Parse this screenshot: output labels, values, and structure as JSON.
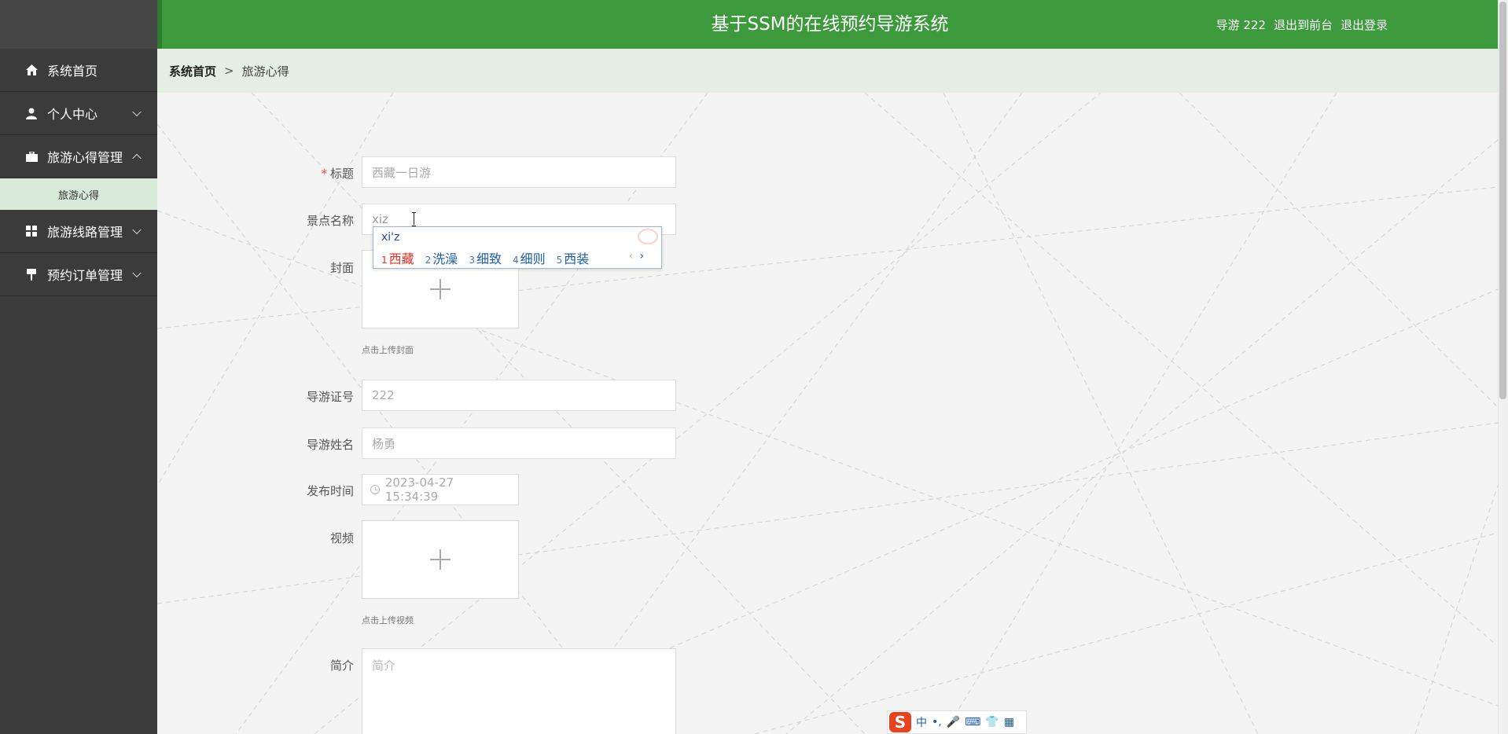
{
  "header": {
    "title": "基于SSM的在线预约导游系统",
    "user": "导游 222",
    "to_frontend": "退出到前台",
    "logout": "退出登录"
  },
  "sidebar": {
    "items": [
      {
        "label": "系统首页",
        "icon": "home-icon"
      },
      {
        "label": "个人中心",
        "icon": "user-icon"
      },
      {
        "label": "旅游心得管理",
        "icon": "briefcase-icon"
      },
      {
        "label": "旅游线路管理",
        "icon": "grid-icon"
      },
      {
        "label": "预约订单管理",
        "icon": "pin-icon"
      }
    ],
    "sub_items": [
      {
        "label": "旅游心得"
      }
    ]
  },
  "breadcrumb": {
    "home": "系统首页",
    "separator": ">",
    "current": "旅游心得"
  },
  "form": {
    "title": {
      "label": "标题",
      "required_mark": "*",
      "placeholder": "西藏一日游"
    },
    "spot": {
      "label": "景点名称",
      "value": "xiz"
    },
    "cover": {
      "label": "封面",
      "hint": "点击上传封面"
    },
    "guide_id": {
      "label": "导游证号",
      "value": "222"
    },
    "guide_name": {
      "label": "导游姓名",
      "value": "杨勇"
    },
    "publish_time": {
      "label": "发布时间",
      "value": "2023-04-27 15:34:39"
    },
    "video": {
      "label": "视频",
      "hint": "点击上传视频"
    },
    "intro": {
      "label": "简介",
      "placeholder": "简介"
    }
  },
  "ime": {
    "composition": "xi'z",
    "candidates": [
      {
        "num": "1",
        "text": "西藏"
      },
      {
        "num": "2",
        "text": "洗澡"
      },
      {
        "num": "3",
        "text": "细致"
      },
      {
        "num": "4",
        "text": "细则"
      },
      {
        "num": "5",
        "text": "西装"
      }
    ],
    "prev": "‹",
    "next": "›"
  },
  "ime_toolbar": {
    "logo": "S",
    "mode": "中",
    "punct": "•,",
    "voice": "🎤",
    "keyboard": "⌨",
    "skin": "👕",
    "tools": "▦"
  },
  "colors": {
    "header_green": "#3c9a3c",
    "sidebar_dark": "#3b3b3b",
    "submenu_active": "#d8ebd8",
    "breadcrumb_bg": "#e4efe4",
    "required": "#e74c3c"
  }
}
